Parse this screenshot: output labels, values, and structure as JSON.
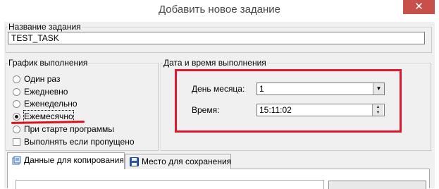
{
  "window": {
    "title": "Добавить новое задание",
    "close_glyph": "✕"
  },
  "task_name": {
    "legend": "Название задания",
    "value": "TEST_TASK"
  },
  "schedule": {
    "legend": "График выполнения",
    "options": [
      {
        "label": "Один раз",
        "selected": false
      },
      {
        "label": "Ежедневно",
        "selected": false
      },
      {
        "label": "Еженедельно",
        "selected": false
      },
      {
        "label": "Ежемесячно",
        "selected": true
      },
      {
        "label": "При старте программы",
        "selected": false
      }
    ],
    "checkbox": {
      "label": "Выполнять если пропущено",
      "checked": false
    }
  },
  "datetime": {
    "legend": "Дата и время выполнения",
    "day_label": "День месяца:",
    "day_value": "1",
    "time_label": "Время:",
    "time_value": "15:11:02"
  },
  "tabs": [
    {
      "label": "Данные для копирования",
      "icon": "copy-data-icon",
      "active": true
    },
    {
      "label": "Место для сохранения",
      "icon": "save-disk-icon",
      "active": false
    }
  ],
  "colors": {
    "highlight": "#e3172e",
    "close_button": "#c7504b"
  }
}
